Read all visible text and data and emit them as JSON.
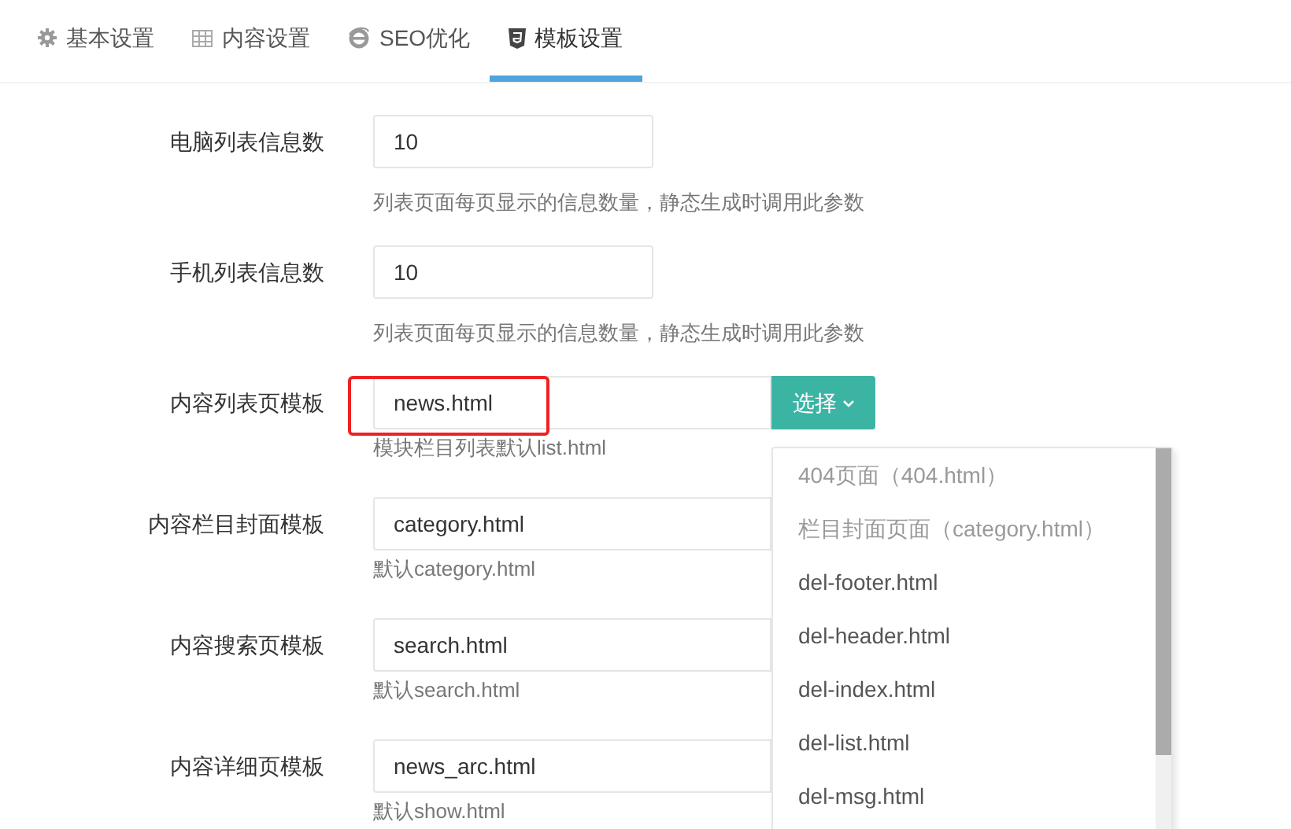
{
  "tabs": [
    {
      "label": "基本设置",
      "selected": false
    },
    {
      "label": "内容设置",
      "selected": false
    },
    {
      "label": "SEO优化",
      "selected": false
    },
    {
      "label": "模板设置",
      "selected": true
    }
  ],
  "fields": [
    {
      "kind": "plain",
      "label": "电脑列表信息数",
      "value": "10",
      "hint": "列表页面每页显示的信息数量，静态生成时调用此参数"
    },
    {
      "kind": "plain",
      "label": "手机列表信息数",
      "value": "10",
      "hint": "列表页面每页显示的信息数量，静态生成时调用此参数"
    },
    {
      "kind": "select",
      "label": "内容列表页模板",
      "value": "news.html",
      "hint": "模块栏目列表默认list.html",
      "button": "选择",
      "highlighted": true
    },
    {
      "kind": "select",
      "label": "内容栏目封面模板",
      "value": "category.html",
      "hint": "默认category.html",
      "highlighted": false
    },
    {
      "kind": "select",
      "label": "内容搜索页模板",
      "value": "search.html",
      "hint": "默认search.html",
      "highlighted": false
    },
    {
      "kind": "select",
      "label": "内容详细页模板",
      "value": "news_arc.html",
      "hint": "默认show.html",
      "highlighted": false
    }
  ],
  "dropdown": {
    "items": [
      {
        "label": "404页面（404.html）",
        "muted": true
      },
      {
        "label": "栏目封面页面（category.html）",
        "muted": true
      },
      {
        "label": "del-footer.html",
        "muted": false
      },
      {
        "label": "del-header.html",
        "muted": false
      },
      {
        "label": "del-index.html",
        "muted": false
      },
      {
        "label": "del-list.html",
        "muted": false
      },
      {
        "label": "del-msg.html",
        "muted": false
      }
    ]
  }
}
